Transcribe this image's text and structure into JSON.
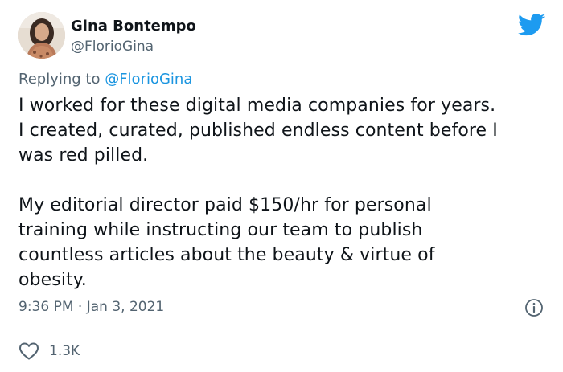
{
  "author": {
    "display_name": "Gina Bontempo",
    "handle": "@FlorioGina"
  },
  "reply": {
    "prefix": "Replying to ",
    "mention": "@FlorioGina"
  },
  "tweet": {
    "lines": [
      "I worked for these digital media companies for years.",
      "I created, curated, published endless content before I",
      "was red pilled."
    ],
    "lines2": [
      "My editorial director paid $150/hr for personal",
      "training while instructing our team to publish",
      "countless articles about the beauty & virtue of",
      "obesity."
    ],
    "timestamp": "9:36 PM · Jan 3, 2021"
  },
  "engagement": {
    "likes": "1.3K"
  },
  "icons": {
    "logo": "twitter-bird-icon",
    "info": "info-icon",
    "like": "heart-icon"
  },
  "colors": {
    "brand": "#1d9bf0",
    "mention": "#1b95e0",
    "secondary_text": "#536471",
    "primary_text": "#0f1419",
    "divider": "#cfd9de"
  }
}
